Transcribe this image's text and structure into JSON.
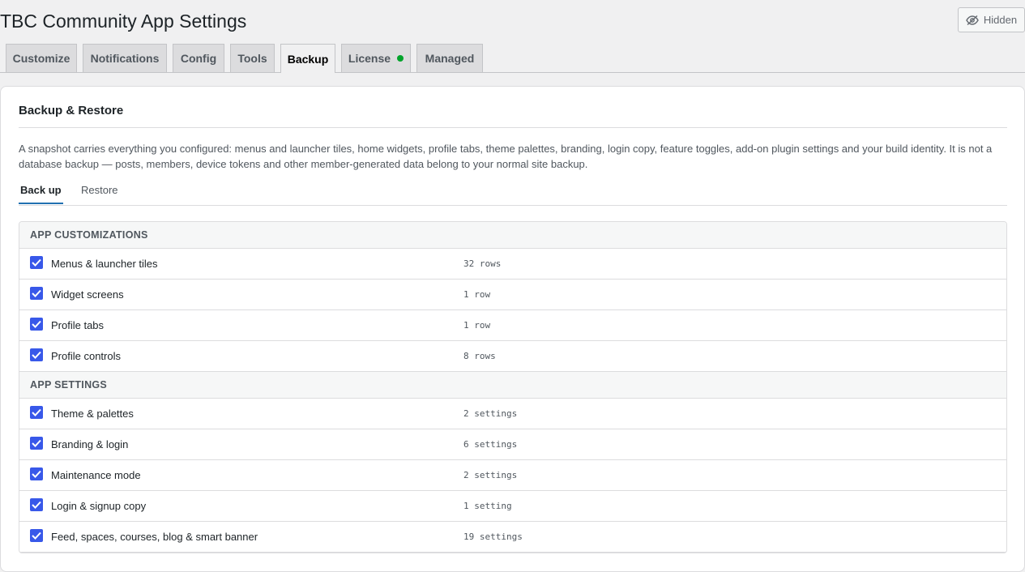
{
  "page": {
    "title": "TBC Community App Settings",
    "hidden_button": "Hidden"
  },
  "tabs": [
    {
      "label": "Customize",
      "active": false
    },
    {
      "label": "Notifications",
      "active": false
    },
    {
      "label": "Config",
      "active": false
    },
    {
      "label": "Tools",
      "active": false
    },
    {
      "label": "Backup",
      "active": true
    },
    {
      "label": "License",
      "active": false,
      "status_color": "#00a32a"
    },
    {
      "label": "Managed",
      "active": false
    }
  ],
  "panel": {
    "title": "Backup & Restore",
    "description": "A snapshot carries everything you configured: menus and launcher tiles, home widgets, profile tabs, theme palettes, branding, login copy, feature toggles, add-on plugin settings and your build identity. It is not a database backup — posts, members, device tokens and other member-generated data belong to your normal site backup.",
    "subtabs": [
      {
        "label": "Back up",
        "active": true
      },
      {
        "label": "Restore",
        "active": false
      }
    ]
  },
  "sections": [
    {
      "header": "App customizations",
      "rows": [
        {
          "label": "Menus & launcher tiles",
          "count": "32 rows",
          "checked": true
        },
        {
          "label": "Widget screens",
          "count": "1 row",
          "checked": true
        },
        {
          "label": "Profile tabs",
          "count": "1 row",
          "checked": true
        },
        {
          "label": "Profile controls",
          "count": "8 rows",
          "checked": true
        }
      ]
    },
    {
      "header": "App settings",
      "rows": [
        {
          "label": "Theme & palettes",
          "count": "2 settings",
          "checked": true
        },
        {
          "label": "Branding & login",
          "count": "6 settings",
          "checked": true
        },
        {
          "label": "Maintenance mode",
          "count": "2 settings",
          "checked": true
        },
        {
          "label": "Login & signup copy",
          "count": "1 setting",
          "checked": true
        },
        {
          "label": "Feed, spaces, courses, blog & smart banner",
          "count": "19 settings",
          "checked": true
        }
      ]
    }
  ],
  "colors": {
    "accent": "#3858e9",
    "tab_underline": "#2271b1",
    "license_status": "#00a32a"
  }
}
